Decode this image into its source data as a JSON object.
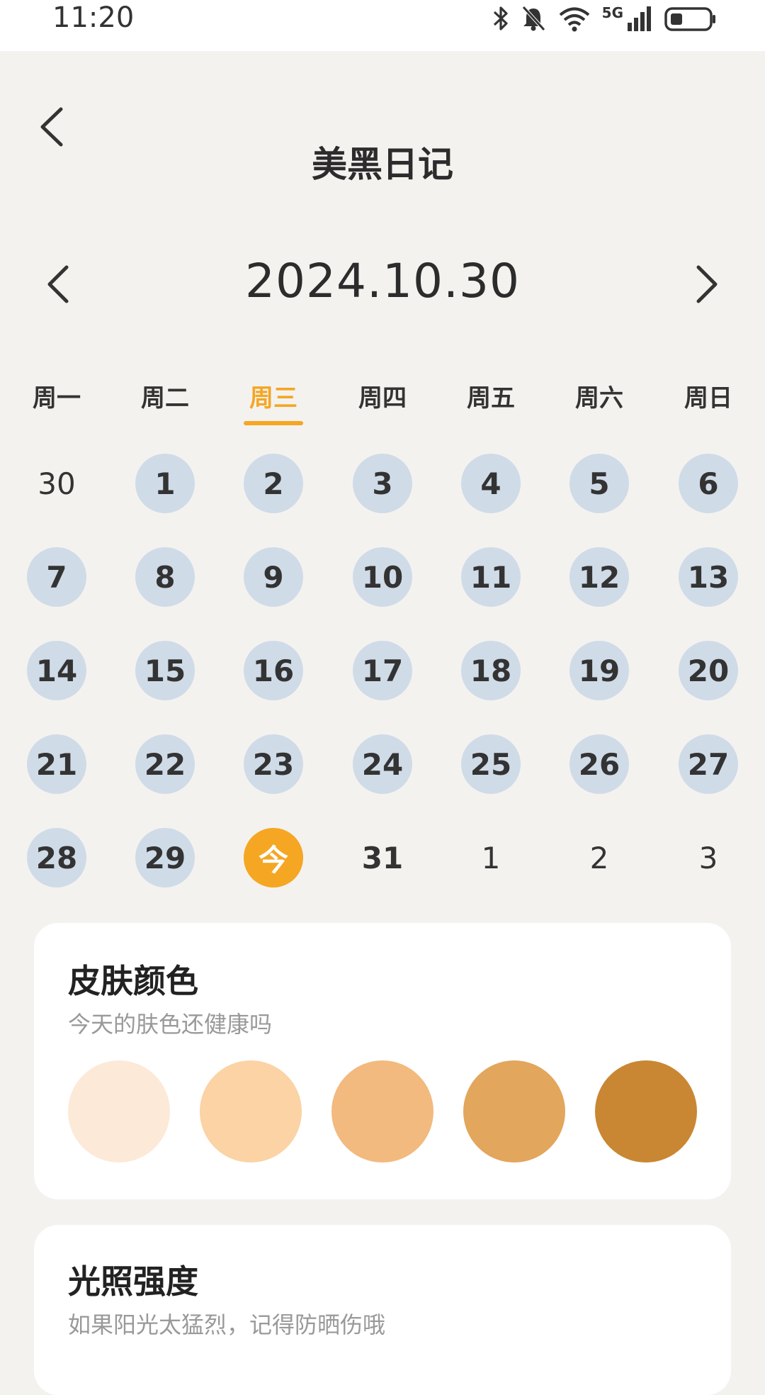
{
  "status_bar": {
    "time": "11:20",
    "signal_label": "5G",
    "icons": [
      "bluetooth-icon",
      "bell-off-icon",
      "wifi-icon",
      "signal-icon",
      "battery-icon"
    ]
  },
  "header": {
    "title": "美黑日记",
    "back_icon": "chevron-left-icon"
  },
  "date_nav": {
    "current": "2024.10.30",
    "prev_icon": "chevron-left-icon",
    "next_icon": "chevron-right-icon"
  },
  "weekdays": [
    "周一",
    "周二",
    "周三",
    "周四",
    "周五",
    "周六",
    "周日"
  ],
  "active_weekday_index": 2,
  "calendar": {
    "rows": [
      [
        "30",
        "1",
        "2",
        "3",
        "4",
        "5",
        "6"
      ],
      [
        "7",
        "8",
        "9",
        "10",
        "11",
        "12",
        "13"
      ],
      [
        "14",
        "15",
        "16",
        "17",
        "18",
        "19",
        "20"
      ],
      [
        "21",
        "22",
        "23",
        "24",
        "25",
        "26",
        "27"
      ],
      [
        "28",
        "29",
        "今",
        "31",
        "1",
        "2",
        "3"
      ]
    ],
    "today_label": "今"
  },
  "skin_card": {
    "title": "皮肤颜色",
    "subtitle": "今天的肤色还健康吗",
    "swatches": [
      "#fde9d8",
      "#fbd3a4",
      "#f2ba7e",
      "#e2a65c",
      "#c98733"
    ]
  },
  "light_card": {
    "title": "光照强度",
    "subtitle": "如果阳光太猛烈，记得防晒伤哦"
  },
  "colors": {
    "accent": "#f5a623",
    "logged_day": "#d0dbe8",
    "background": "#f4f2ef"
  }
}
